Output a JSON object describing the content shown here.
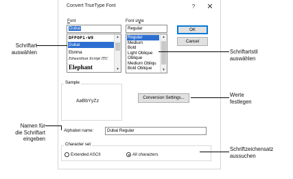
{
  "dialog": {
    "title": "Convert TrueType Font",
    "help_glyph": "?",
    "close_glyph": "✕"
  },
  "font": {
    "label_prefix": "",
    "label_underlined": "F",
    "label_rest": "ont",
    "value": "Dubai",
    "items": [
      "DFPOP1-W9",
      "Dubai",
      "Ebrima",
      "Edwardian Script ITC",
      "Elephant"
    ],
    "selected_index": 1
  },
  "style": {
    "label_prefix": "Font st",
    "label_underlined": "y",
    "label_rest": "le",
    "value": "Regular",
    "items": [
      "Regular",
      "Medium",
      "Bold",
      "Light Oblique",
      "Oblique",
      "Medium Obliqu",
      "Bold Oblique"
    ],
    "selected_index": 0
  },
  "buttons": {
    "ok": "OK",
    "cancel": "Cancel",
    "conversion_settings": "Conversion Settings..."
  },
  "sample": {
    "caption": "Sample",
    "text": "AaBbYyZz"
  },
  "alphabet": {
    "label": "Alphabet name:",
    "value": "Dubai Regular"
  },
  "character_set": {
    "caption": "Character set",
    "options": [
      "Extended ASCII",
      "All characters"
    ],
    "selected_index": 1
  },
  "callouts": {
    "select_font": [
      "Schriftart",
      "auswählen"
    ],
    "select_style": [
      "Schriftartstil",
      "auswählen"
    ],
    "set_values": [
      "Werte",
      "festlegen"
    ],
    "name_font": [
      "Namen für",
      "die Schriftart",
      "eingeben"
    ],
    "select_charset": [
      "Schriftzeichensatz",
      "aussuchen"
    ]
  },
  "colors": {
    "selection": "#2d6fd1",
    "default_button_border": "#0078d7"
  }
}
